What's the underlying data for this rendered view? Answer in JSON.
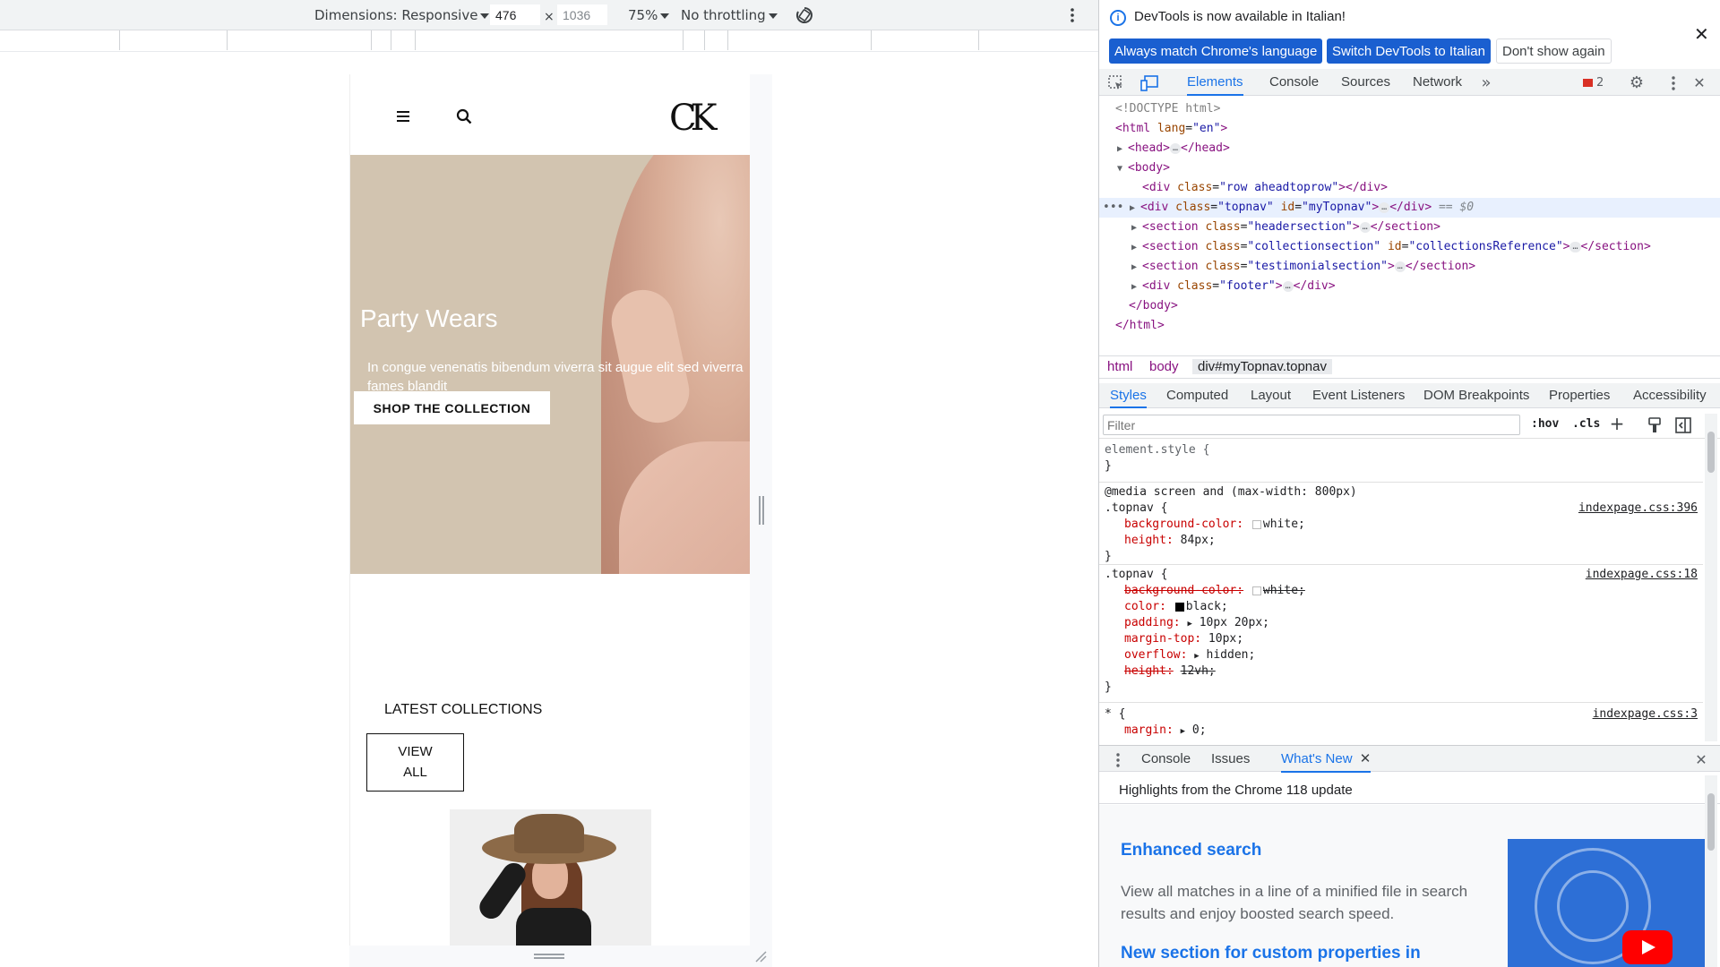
{
  "emulation_toolbar": {
    "dimensions_label": "Dimensions: Responsive",
    "width_value": "476",
    "times_sign": "×",
    "height_value": "1036",
    "zoom": "75%",
    "throttling": "No throttling"
  },
  "site": {
    "logo": "CK",
    "hero": {
      "title": "Party Wears",
      "subtitle": "In congue venenatis bibendum viverra sit augue elit sed viverra fames blandit",
      "cta": "SHOP THE COLLECTION"
    },
    "latest_collections": "LATEST COLLECTIONS",
    "view_all_line1": "VIEW",
    "view_all_line2": "ALL"
  },
  "devtools": {
    "infobar": {
      "message": "DevTools is now available in Italian!",
      "btn_match": "Always match Chrome's language",
      "btn_switch": "Switch DevTools to Italian",
      "btn_dont_show": "Don't show again"
    },
    "tabs": [
      "Elements",
      "Console",
      "Sources",
      "Network"
    ],
    "issues_count": "2",
    "dom": {
      "doctype": "<!DOCTYPE html>",
      "html_open": "<html",
      "html_lang_attr": "lang",
      "html_lang_val": "\"en\"",
      "html_close_bracket": ">",
      "head_open": "<head>",
      "head_close": "</head>",
      "body_open": "<body>",
      "line_aheadtoprow_open": "<div",
      "line_aheadtoprow_attr": "class",
      "line_aheadtoprow_val": "\"row aheadtoprow\"",
      "line_aheadtoprow_close": "></div>",
      "topnav_open": "<div",
      "topnav_class_attr": "class",
      "topnav_class_val": "\"topnav\"",
      "topnav_id_attr": "id",
      "topnav_id_val": "\"myTopnav\"",
      "topnav_gt": ">",
      "topnav_close": "</div>",
      "topnav_ref": "== $0",
      "headersection_open": "<section",
      "headersection_attr": "class",
      "headersection_val": "\"headersection\"",
      "headersection_gt": ">",
      "section_close": "</section>",
      "collection_open": "<section",
      "collection_class_attr": "class",
      "collection_class_val": "\"collectionsection\"",
      "collection_id_attr": "id",
      "collection_id_val": "\"collectionsReference\"",
      "collection_gt": ">",
      "testimonial_open": "<section",
      "testimonial_attr": "class",
      "testimonial_val": "\"testimonialsection\"",
      "testimonial_gt": ">",
      "footer_open": "<div",
      "footer_attr": "class",
      "footer_val": "\"footer\"",
      "footer_gt": ">",
      "div_close": "</div>",
      "body_close": "</body>",
      "html_close": "</html>",
      "ellipsis": "…"
    },
    "breadcrumbs": [
      "html",
      "body",
      "div#myTopnav.topnav"
    ],
    "styles_tabs": [
      "Styles",
      "Computed",
      "Layout",
      "Event Listeners",
      "DOM Breakpoints",
      "Properties",
      "Accessibility"
    ],
    "filter_placeholder": "Filter",
    "hov": ":hov",
    "cls": ".cls",
    "styles": {
      "element_style": "element.style {",
      "close_brace": "}",
      "media": "@media screen and (max-width: 800px)",
      "topnav_sel": ".topnav {",
      "src1": "indexpage.css:396",
      "bg_prop": "background-color:",
      "bg_val": "white;",
      "height_prop": "height:",
      "height_val": "84px;",
      "src2": "indexpage.css:18",
      "color_prop": "color:",
      "color_val": "black;",
      "padding_prop": "padding:",
      "padding_val": "10px 20px;",
      "margintop_prop": "margin-top:",
      "margintop_val": "10px;",
      "overflow_prop": "overflow:",
      "overflow_val": "hidden;",
      "height2_prop": "height:",
      "height2_val": "12vh;",
      "star_sel": "* {",
      "src3": "indexpage.css:3",
      "margin_prop": "margin:",
      "margin_val": "0;"
    },
    "drawer_tabs": [
      "Console",
      "Issues",
      "What's New"
    ],
    "whats_new": {
      "highlights": "Highlights from the Chrome 118 update",
      "h1": "Enhanced search",
      "p1": "View all matches in a line of a minified file in search results and enjoy boosted search speed.",
      "h2": "New section for custom properties in"
    }
  }
}
